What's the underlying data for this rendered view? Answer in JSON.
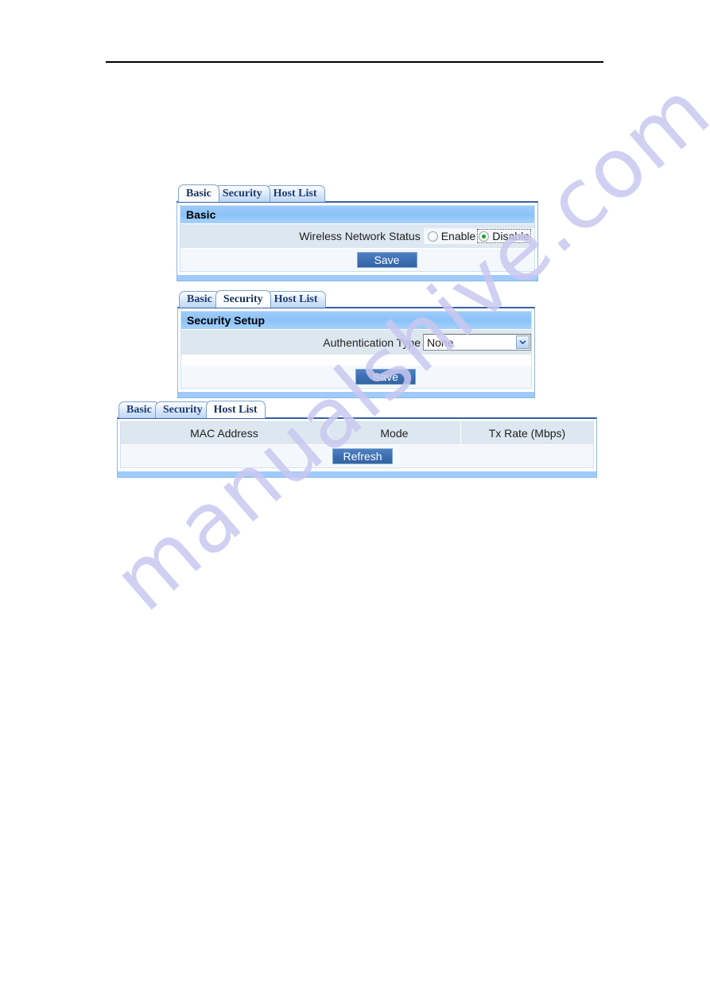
{
  "document": {
    "watermark_text": "manualshive.com",
    "watermark_color": "#c9c8f0",
    "page_background": "#ffffff",
    "header_rule": true
  },
  "theme": {
    "accent_blue": "#3d6fb4",
    "header_bar_blue": "#8bc2f8",
    "row_blue_gray": "#dde7f0",
    "tab_text_color": "#1f3d73",
    "radio_selected_color": "#15a515"
  },
  "panels": [
    {
      "id": "basic",
      "tabs": [
        {
          "label": "Basic",
          "active": true
        },
        {
          "label": "Security",
          "active": false
        },
        {
          "label": "Host List",
          "active": false
        }
      ],
      "section_title": "Basic",
      "field_label": "Wireless Network Status",
      "radios": [
        {
          "label": "Enable",
          "checked": false,
          "focused": false
        },
        {
          "label": "Disable",
          "checked": true,
          "focused": true
        }
      ],
      "button_label": "Save"
    },
    {
      "id": "security",
      "tabs": [
        {
          "label": "Basic",
          "active": false
        },
        {
          "label": "Security",
          "active": true
        },
        {
          "label": "Host List",
          "active": false
        }
      ],
      "section_title": "Security Setup",
      "field_label": "Authentication Type",
      "select_value": "None",
      "button_label": "Save"
    },
    {
      "id": "hostlist",
      "tabs": [
        {
          "label": "Basic",
          "active": false
        },
        {
          "label": "Security",
          "active": false
        },
        {
          "label": "Host List",
          "active": true
        }
      ],
      "table_headers": [
        "MAC Address",
        "Mode",
        "Tx Rate (Mbps)"
      ],
      "table_rows": [],
      "button_label": "Refresh"
    }
  ]
}
